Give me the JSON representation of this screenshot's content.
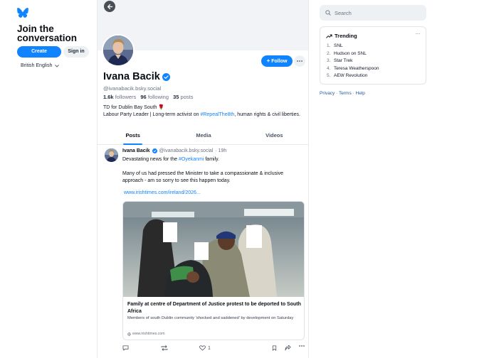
{
  "sidebar": {
    "join_title": "Join the conversation",
    "create_account": "Create account",
    "sign_in": "Sign in",
    "language": "British English"
  },
  "profile": {
    "name": "Ivana Bacik",
    "handle": "@ivanabacik.bsky.social",
    "followers_count": "1.6k",
    "followers_label": "followers",
    "following_count": "96",
    "following_label": "following",
    "posts_count": "35",
    "posts_label": "posts",
    "bio_line1": "TD for Dublin Bay South 🌹",
    "bio_line2_a": "Labour Party Leader | Long-term activist on ",
    "bio_hashtag": "#RepealThe8th",
    "bio_line2_b": ", human rights & civil liberties.",
    "follow_label": "Follow"
  },
  "tabs": [
    "Posts",
    "Media",
    "Videos"
  ],
  "post": {
    "author": "Ivana Bacik",
    "handle": "@ivanabacik.bsky.social",
    "time": "· 19h",
    "line1_a": "Devastating news for the ",
    "line1_hashtag": "#Oyekanmi",
    "line1_b": " family.",
    "para2": "Many of us had pressed the Minister to take a compassionate & inclusive approach - am so sorry to see this happen today.",
    "link": "www.irishtimes.com/ireland/2026...",
    "card_title": "Family at centre of Department of Justice protest to be deported to South Africa",
    "card_desc": "Members of south Dublin community 'shocked and saddened' by development on Saturday",
    "card_source": "www.irishtimes.com",
    "like_count": "1"
  },
  "right": {
    "search_placeholder": "Search",
    "trending_title": "Trending",
    "trending": [
      {
        "n": "1.",
        "label": "SNL"
      },
      {
        "n": "2.",
        "label": "Hudson on SNL"
      },
      {
        "n": "3.",
        "label": "Star Trek"
      },
      {
        "n": "4.",
        "label": "Teresa Weatherspoon"
      },
      {
        "n": "5.",
        "label": "AEW Revolution"
      }
    ],
    "privacy": "Privacy",
    "terms": "Terms",
    "help": "Help",
    "sep": "·"
  },
  "colors": {
    "accent": "#1083fe",
    "link": "#1083fe",
    "muted": "#6b7280"
  }
}
